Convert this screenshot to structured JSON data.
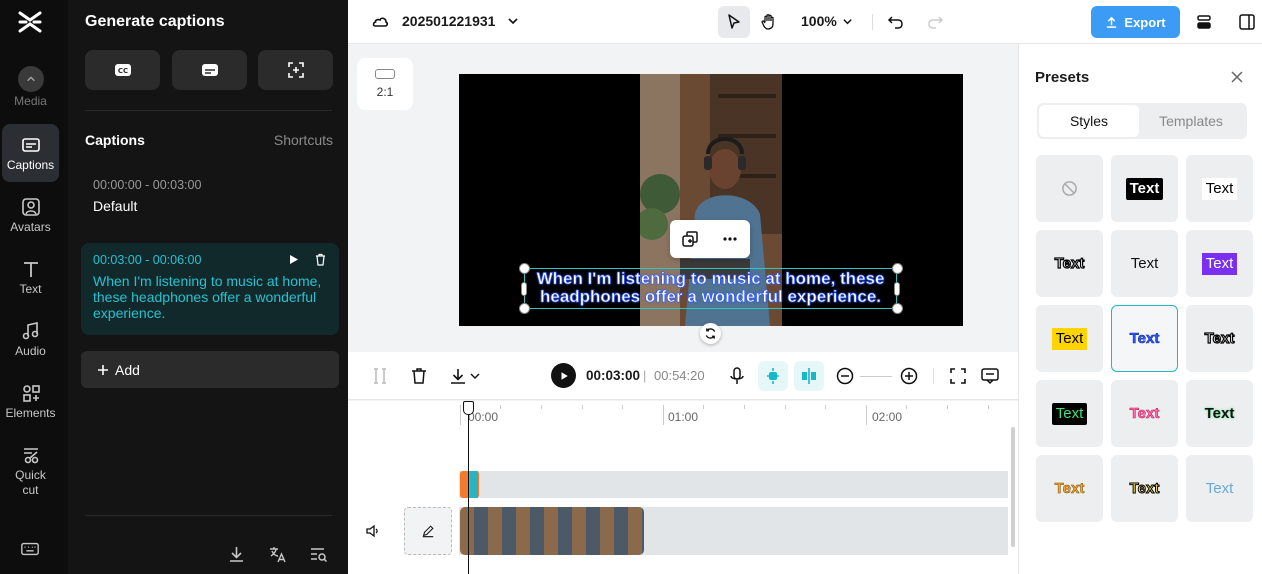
{
  "rail": {
    "items": [
      {
        "label": "Media"
      },
      {
        "label": "Captions"
      },
      {
        "label": "Avatars"
      },
      {
        "label": "Text"
      },
      {
        "label": "Audio"
      },
      {
        "label": "Elements"
      },
      {
        "label": "Quick cut"
      }
    ]
  },
  "panel": {
    "title": "Generate captions",
    "captions_header": "Captions",
    "shortcuts": "Shortcuts",
    "captions": [
      {
        "time": "00:00:00 - 00:03:00",
        "text": "Default"
      },
      {
        "time": "00:03:00 - 00:06:00",
        "text": "When I'm listening to music at home, these headphones offer a wonderful experience."
      }
    ],
    "add_label": "Add"
  },
  "topbar": {
    "project_name": "202501221931",
    "zoom": "100%",
    "export_label": "Export"
  },
  "canvas": {
    "ratio": "2:1",
    "caption_text": "When I'm listening to music at home, these headphones offer a wonderful experience."
  },
  "playback": {
    "current": "00:03:00",
    "separator": "|",
    "duration": "00:54:20"
  },
  "timeline": {
    "ruler": [
      "00:00",
      "01:00",
      "02:00"
    ]
  },
  "presets": {
    "title": "Presets",
    "tabs": [
      "Styles",
      "Templates"
    ],
    "sample_text": "Text",
    "accent": "#2ab3c0"
  }
}
